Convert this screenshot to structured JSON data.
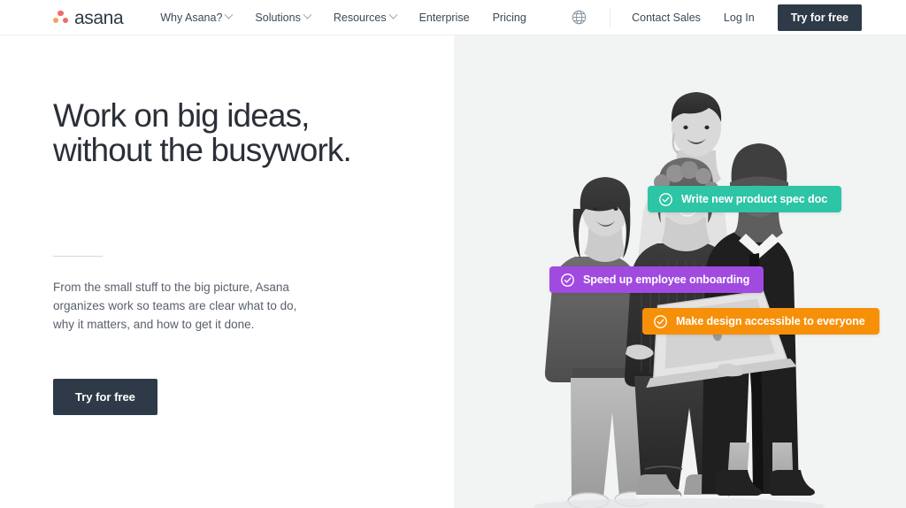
{
  "brand": {
    "name": "asana",
    "logo_icon": "asana-dots-logo",
    "dot_colors": [
      "#f06a6a",
      "#f8a15e",
      "#f06a6a"
    ]
  },
  "navbar": {
    "links": [
      {
        "label": "Why Asana?",
        "has_dropdown": true,
        "icon": "chevron-down-icon"
      },
      {
        "label": "Solutions",
        "has_dropdown": true,
        "icon": "chevron-down-icon"
      },
      {
        "label": "Resources",
        "has_dropdown": true,
        "icon": "chevron-down-icon"
      },
      {
        "label": "Enterprise",
        "has_dropdown": false,
        "icon": ""
      },
      {
        "label": "Pricing",
        "has_dropdown": false,
        "icon": ""
      }
    ],
    "language_icon": "globe-icon",
    "contact_sales_label": "Contact Sales",
    "login_label": "Log In",
    "try_free_label": "Try for free",
    "try_free_bg": "#2e3a47"
  },
  "hero": {
    "title": "Work on big ideas,\nwithout the busywork.",
    "subtitle": "From the small stuff to the big picture, Asana\norganizes work so teams are clear what to do,\nwhy it matters, and how to get it done.",
    "cta_label": "Try for free",
    "cta_bg": "#2e3a47",
    "left_bg": "#ffffff",
    "right_bg": "#f1f4f3",
    "image_alt": "four-people-with-laptop-photo"
  },
  "task_pills": [
    {
      "label": "Write new product spec doc",
      "color": "#2ec4a6",
      "icon": "check-circle-icon"
    },
    {
      "label": "Speed up employee onboarding",
      "color": "#a14ae0",
      "icon": "check-circle-icon"
    },
    {
      "label": "Make design accessible to everyone",
      "color": "#f79009",
      "icon": "check-circle-icon"
    }
  ]
}
